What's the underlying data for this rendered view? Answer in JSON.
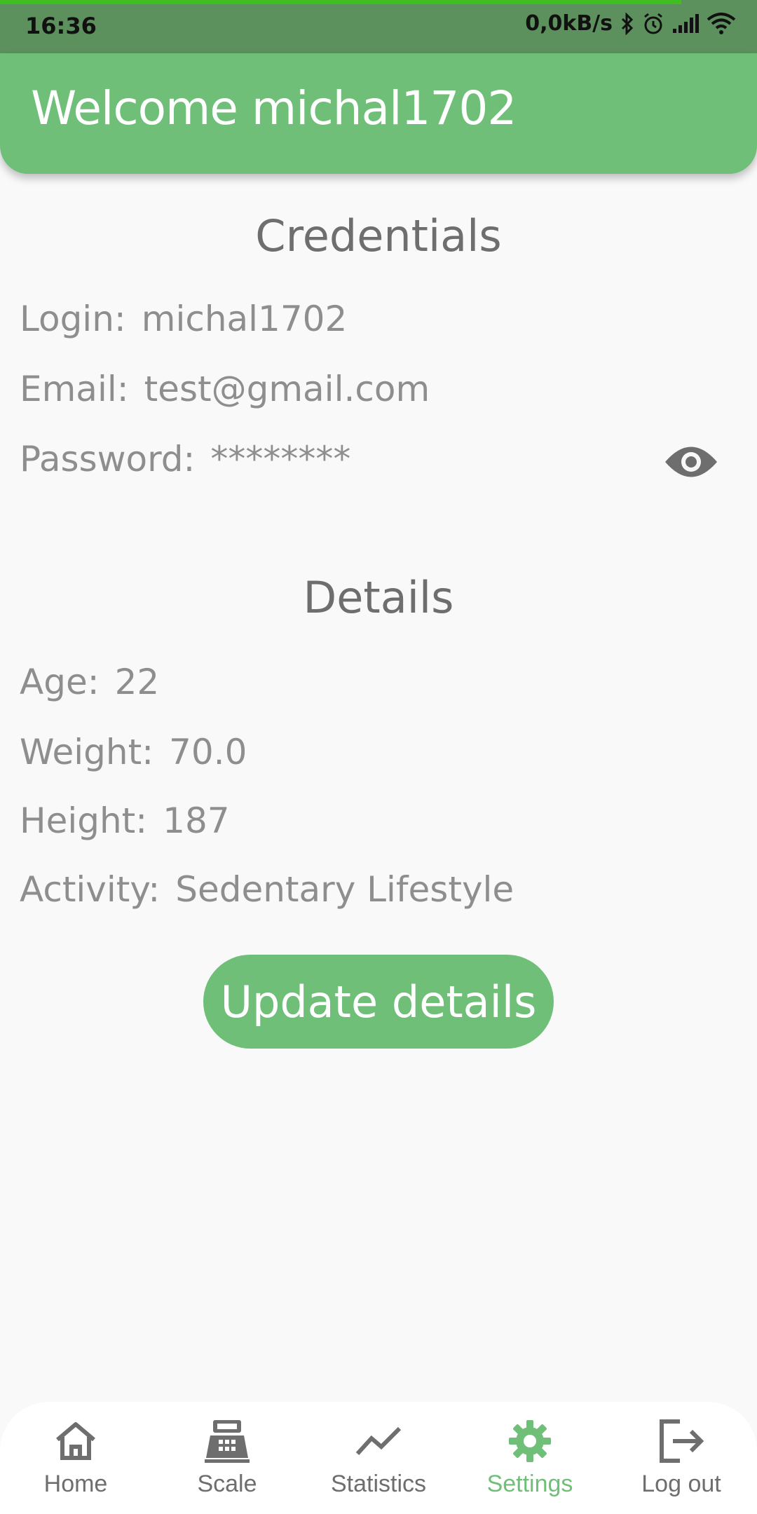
{
  "status_bar": {
    "time": "16:36",
    "network_speed": "0,0kB/s",
    "icons": [
      "bluetooth-icon",
      "alarm-icon",
      "signal-icon",
      "wifi-icon"
    ]
  },
  "header": {
    "title": "Welcome michal1702"
  },
  "credentials": {
    "title": "Credentials",
    "login_label": "Login:",
    "login_value": "michal1702",
    "email_label": "Email:",
    "email_value": "test@gmail.com",
    "password_label": "Password:",
    "password_value": "********",
    "toggle_icon": "eye-icon"
  },
  "details": {
    "title": "Details",
    "age_label": "Age:",
    "age_value": "22",
    "weight_label": "Weight:",
    "weight_value": "70.0",
    "height_label": "Height:",
    "height_value": "187",
    "activity_label": "Activity:",
    "activity_value": "Sedentary Lifestyle",
    "update_button": "Update details"
  },
  "bottom_nav": {
    "items": [
      {
        "label": "Home",
        "icon": "home-icon",
        "active": false
      },
      {
        "label": "Scale",
        "icon": "scale-icon",
        "active": false
      },
      {
        "label": "Statistics",
        "icon": "statistics-icon",
        "active": false
      },
      {
        "label": "Settings",
        "icon": "gear-icon",
        "active": true
      },
      {
        "label": "Log out",
        "icon": "logout-icon",
        "active": false
      }
    ]
  },
  "colors": {
    "accent": "#70bf78",
    "status_bar": "#5c915e",
    "text_primary": "#6e6e6e",
    "text_secondary": "#8e8e8e",
    "background": "#f9f9f9"
  }
}
